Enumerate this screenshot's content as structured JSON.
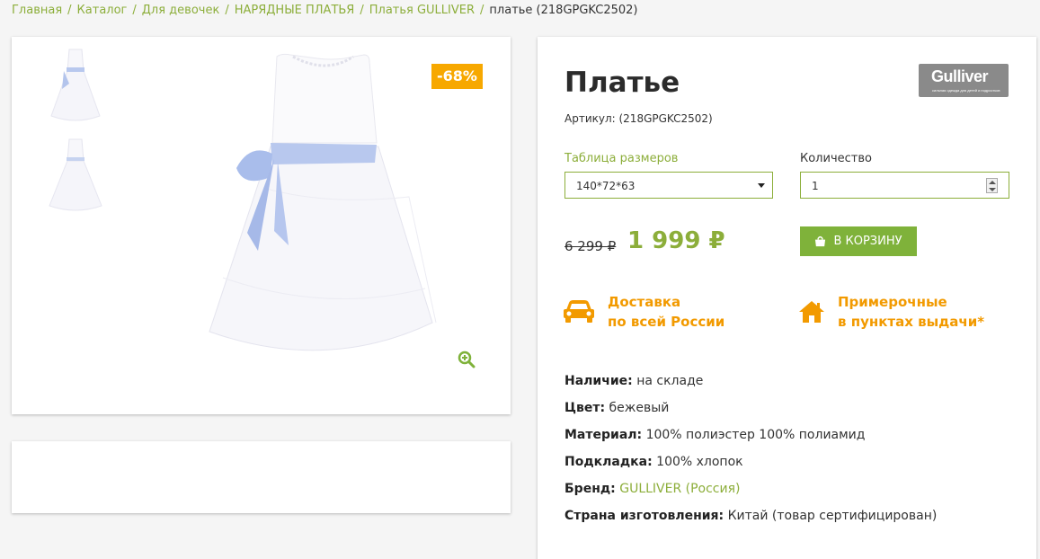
{
  "breadcrumb": {
    "items": [
      "Главная",
      "Каталог",
      "Для девочек",
      "НАРЯДНЫЕ ПЛАТЬЯ",
      "Платья GULLIVER"
    ],
    "current": "платье (218GPGKC2502)"
  },
  "gallery": {
    "discount": "-68%",
    "icons": {
      "zoom": "zoom-in-icon"
    }
  },
  "product": {
    "title": "Платье",
    "brand_logo": "Gulliver",
    "brand_logo_sub": "сильная одежда для детей и подростков",
    "article": "Артикул: (218GPGKC2502)",
    "size_label": "Таблица размеров",
    "size_value": "140*72*63",
    "qty_label": "Количество",
    "qty_value": "1",
    "old_price": "6 299 ₽",
    "new_price": "1 999 ₽",
    "cart_button": "В КОРЗИНУ"
  },
  "features": {
    "delivery_line1": "Доставка",
    "delivery_line2": "по всей России",
    "fitting_line1": "Примерочные",
    "fitting_line2": "в пунктах выдачи*"
  },
  "properties": [
    {
      "label": "Наличие:",
      "value": "на складе"
    },
    {
      "label": "Цвет:",
      "value": "бежевый"
    },
    {
      "label": "Материал:",
      "value": "100% полиэстер 100% полиамид"
    },
    {
      "label": "Подкладка:",
      "value": "100% хлопок"
    },
    {
      "label": "Бренд:",
      "value": "GULLIVER (Россия)"
    },
    {
      "label": "Страна изготовления:",
      "value": "Китай (товар сертифицирован)"
    }
  ],
  "colors": {
    "accent_green": "#8cae3a",
    "button_green": "#7fb23a",
    "orange": "#f29a00",
    "badge": "#f7a800"
  }
}
